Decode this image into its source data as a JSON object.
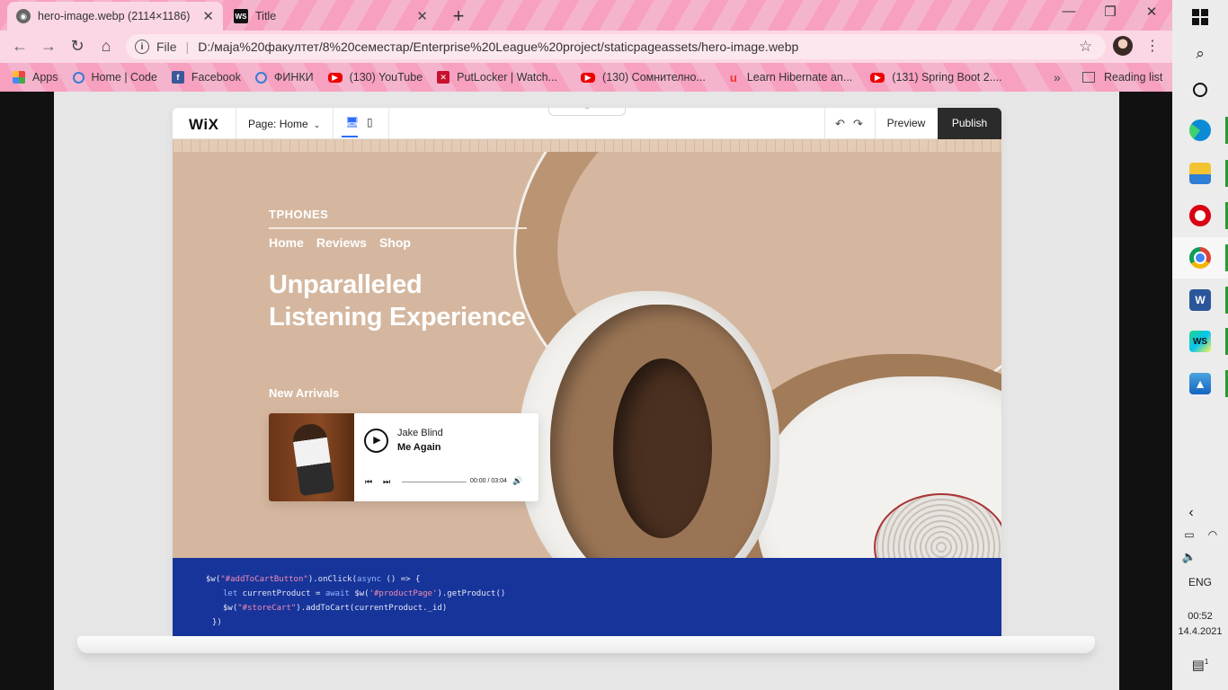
{
  "browser": {
    "tabs": [
      {
        "title": "hero-image.webp (2114×1186)",
        "icon": "globe-icon",
        "active": true
      },
      {
        "title": "Title",
        "icon": "webstorm-icon",
        "active": false
      }
    ],
    "address": {
      "scheme_label": "File",
      "url": "D:/маја%20факултет/8%20семестар/Enterprise%20League%20project/staticpageassets/hero-image.webp"
    },
    "bookmarks": [
      {
        "label": "Apps",
        "icon": "apps-grid-icon"
      },
      {
        "label": "Home | Code",
        "icon": "io-icon"
      },
      {
        "label": "Facebook",
        "icon": "facebook-icon"
      },
      {
        "label": "ФИНКИ",
        "icon": "io-icon"
      },
      {
        "label": "(130) YouTube",
        "icon": "youtube-icon"
      },
      {
        "label": "PutLocker | Watch...",
        "icon": "putlocker-icon"
      },
      {
        "label": "(130) Сомнително...",
        "icon": "youtube-icon"
      },
      {
        "label": "Learn Hibernate an...",
        "icon": "udemy-icon"
      },
      {
        "label": "(131) Spring Boot 2....",
        "icon": "youtube-icon"
      }
    ],
    "bookmarks_more": "»",
    "reading_list": "Reading list"
  },
  "editor": {
    "logo": "WiX",
    "page_selector": "Page: Home",
    "preview": "Preview",
    "publish": "Publish",
    "colors": {
      "publish_bg": "#2b2b2b",
      "hero_bg": "#d5b79f",
      "code_bg": "#17349a",
      "device_active": "#2f6bff"
    }
  },
  "hero": {
    "brand": "TPHONES",
    "nav": [
      "Home",
      "Reviews",
      "Shop"
    ],
    "headline_line1": "Unparalleled",
    "headline_line2": "Listening Experience",
    "section_label": "New Arrivals",
    "player": {
      "artist": "Jake Blind",
      "song": "Me Again",
      "time": "00:00 / 03:04",
      "progress": 0
    }
  },
  "code": {
    "line1": {
      "a": "$w(",
      "b": "\"#addToCartButton\"",
      "c": ").onClick(",
      "d": "async",
      "e": " () => {"
    },
    "line2": {
      "a": "let",
      "b": " currentProduct = ",
      "c": "await",
      "d": " $w(",
      "e": "'#productPage'",
      "f": ").getProduct()"
    },
    "line3": {
      "a": "$w(",
      "b": "\"#storeCart\"",
      "c": ").addToCart(currentProduct._id)"
    },
    "line4": "})"
  },
  "taskbar": {
    "apps": [
      {
        "name": "Microsoft Edge",
        "icon": "edge-icon"
      },
      {
        "name": "File Explorer",
        "icon": "folder-icon"
      },
      {
        "name": "Opera",
        "icon": "opera-icon"
      },
      {
        "name": "Google Chrome",
        "icon": "chrome-icon"
      },
      {
        "name": "Word",
        "icon": "word-icon",
        "glyph": "W"
      },
      {
        "name": "WebStorm",
        "icon": "webstorm-icon",
        "glyph": "WS"
      },
      {
        "name": "Photos",
        "icon": "photos-icon"
      }
    ],
    "language": "ENG",
    "time": "00:52",
    "date": "14.4.2021",
    "notifications": "1"
  }
}
